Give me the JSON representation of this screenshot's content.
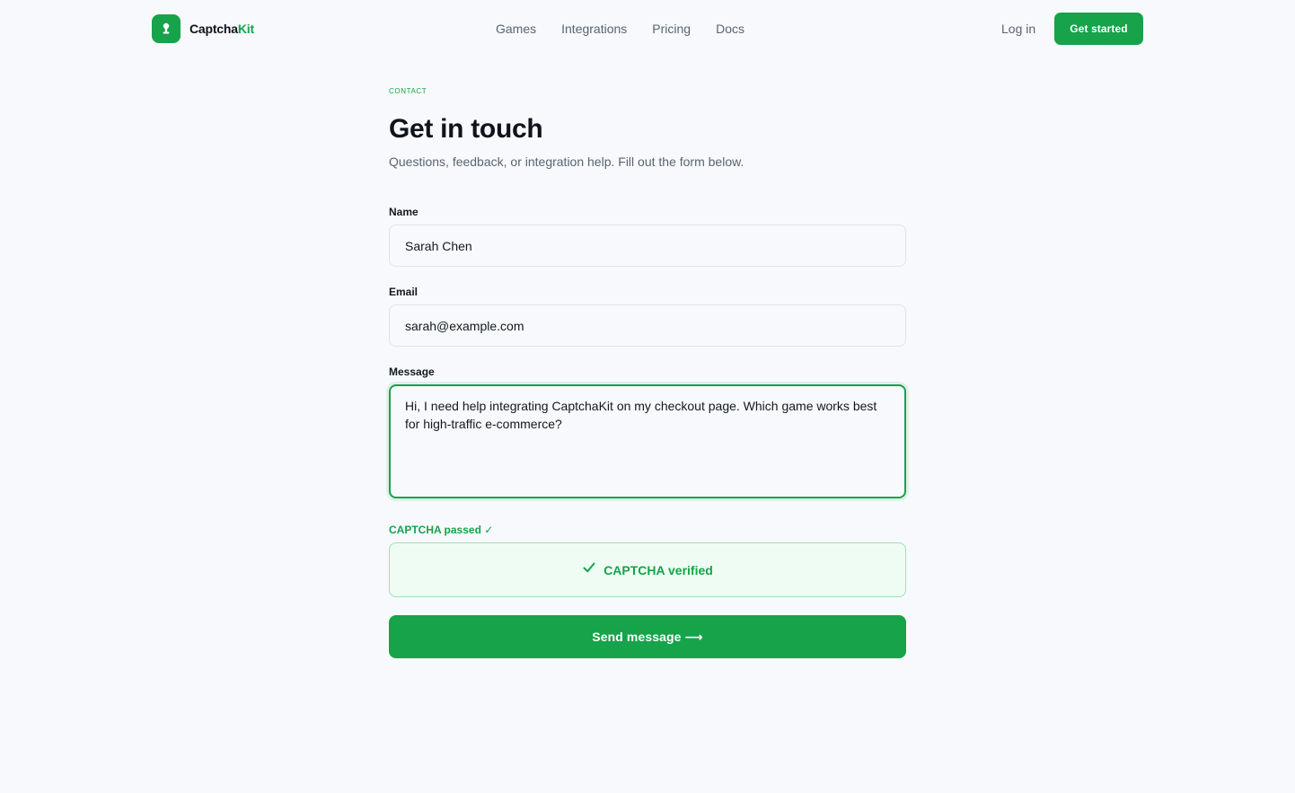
{
  "brand": {
    "name_main": "Captcha",
    "name_accent": "Kit",
    "logo_icon": "keyhole-icon",
    "accent_color": "#16a34a"
  },
  "nav": {
    "items": [
      "Games",
      "Integrations",
      "Pricing",
      "Docs"
    ],
    "login_label": "Log in",
    "cta_label": "Get started"
  },
  "page": {
    "eyebrow": "CONTACT",
    "title": "Get in touch",
    "subtitle": "Questions, feedback, or integration help. Fill out the form below."
  },
  "form": {
    "name": {
      "label": "Name",
      "value": "Sarah Chen"
    },
    "email": {
      "label": "Email",
      "value": "sarah@example.com"
    },
    "message": {
      "label": "Message",
      "value": "Hi, I need help integrating CaptchaKit on my checkout page. Which game works best for high-traffic e-commerce?"
    },
    "captcha_status": "CAPTCHA passed ✓",
    "captcha_verified": "CAPTCHA verified",
    "submit_label": "Send message",
    "submit_arrow": "⟶"
  }
}
